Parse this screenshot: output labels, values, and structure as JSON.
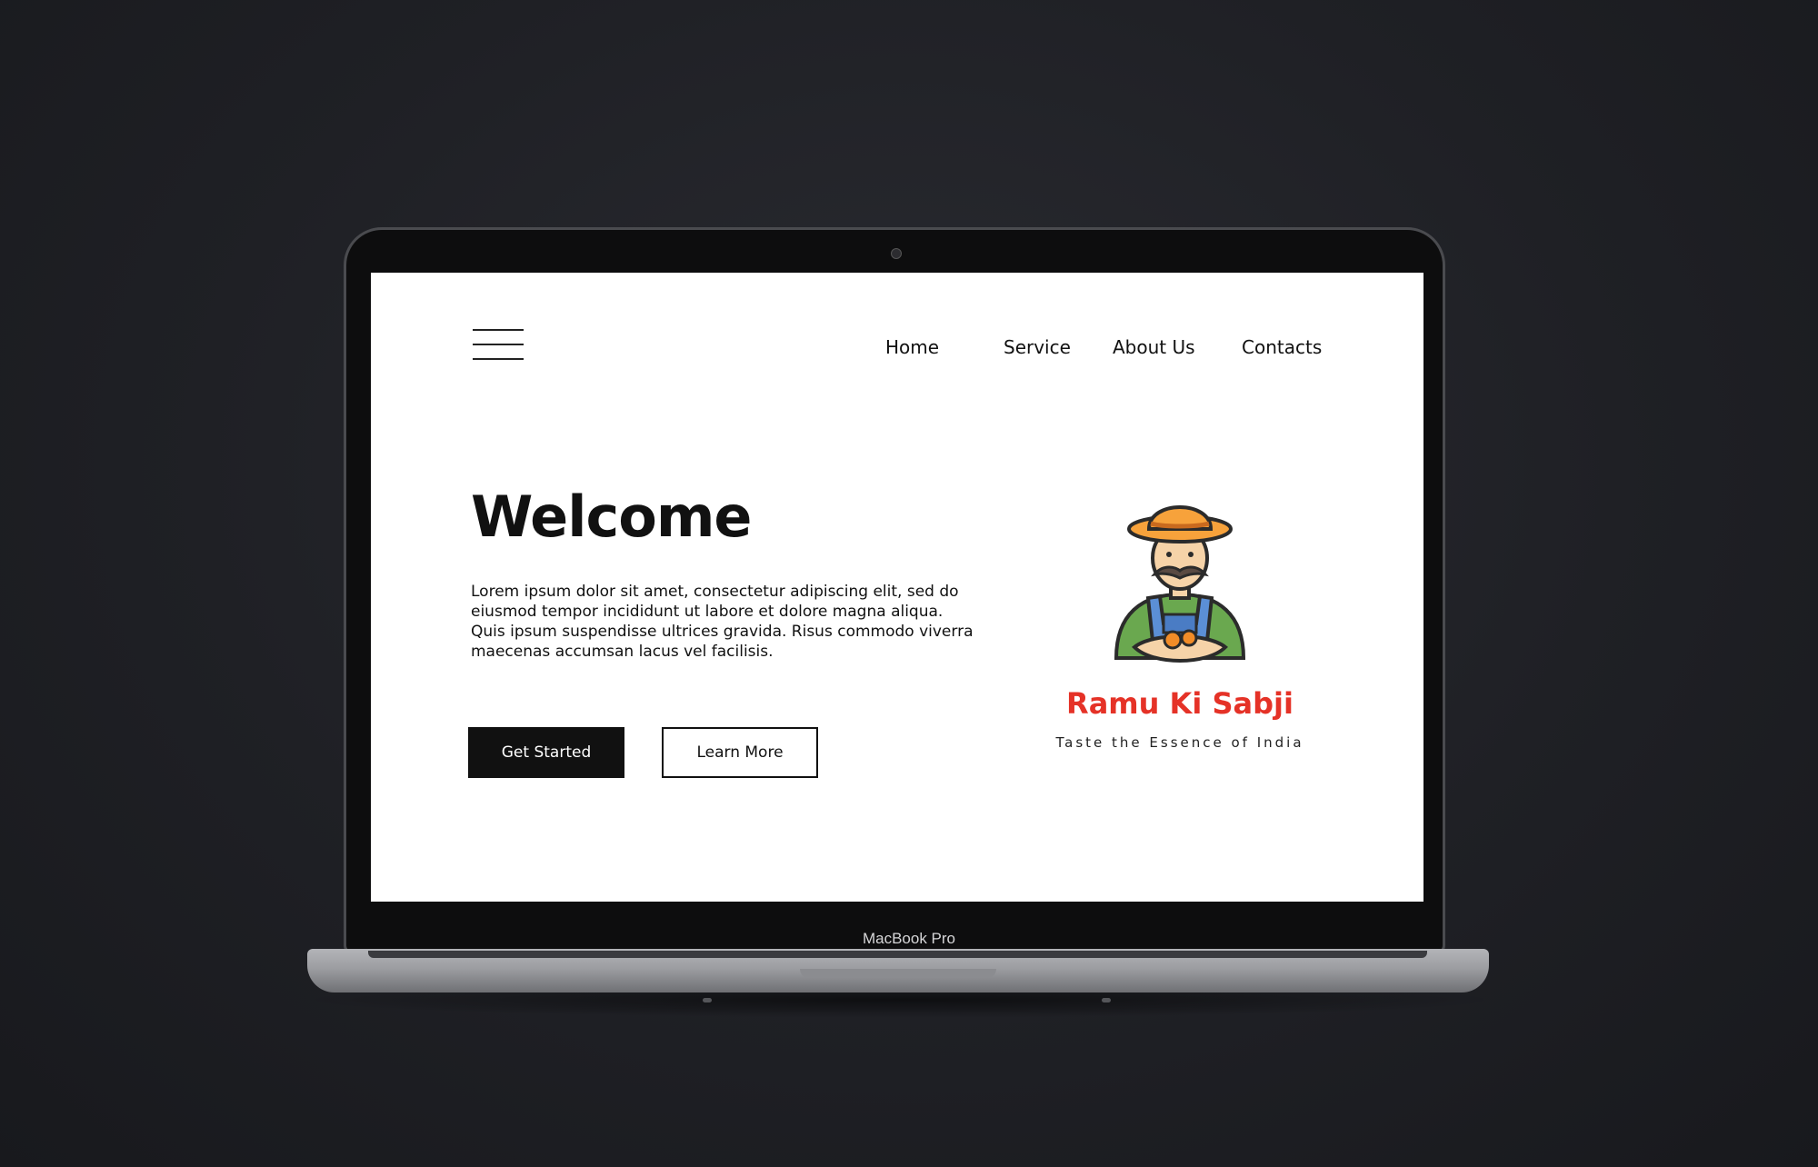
{
  "device": {
    "model_label": "MacBook Pro"
  },
  "site": {
    "nav": [
      "Home",
      "Service",
      "About Us",
      "Contacts"
    ],
    "hero": {
      "title": "Welcome",
      "body": "Lorem ipsum dolor sit amet, consectetur adipiscing elit, sed do eiusmod tempor incididunt ut labore et dolore magna aliqua. Quis ipsum suspendisse ultrices gravida. Risus commodo viverra maecenas accumsan lacus vel facilisis.",
      "primary_button": "Get Started",
      "secondary_button": "Learn More"
    },
    "brand": {
      "name": "Ramu Ki Sabji",
      "tagline": "Taste the Essence of India",
      "name_color": "#e53227"
    },
    "icons": {
      "menu": "hamburger-menu-icon",
      "logo": "farmer-mascot-logo"
    }
  }
}
